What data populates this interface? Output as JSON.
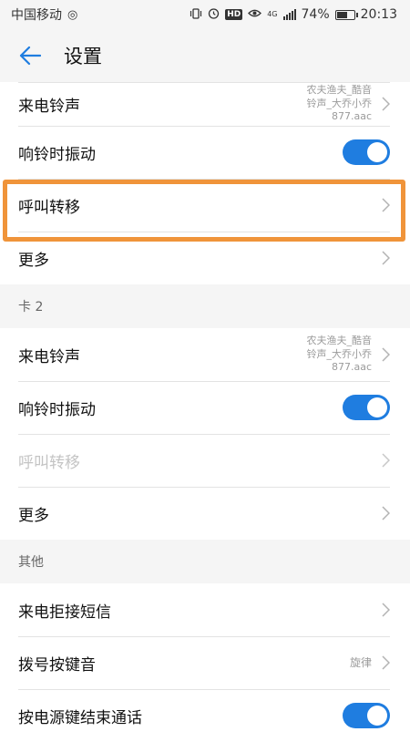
{
  "status_bar": {
    "carrier": "中国移动",
    "network_type": "4G",
    "battery": "74%",
    "battery_fraction": 0.74,
    "time": "20:13"
  },
  "header": {
    "back_icon": "arrow-left-icon",
    "title": "设置"
  },
  "sim1": {
    "ringtone_label": "来电铃声",
    "ringtone_value_line1": "农夫渔夫_酷音",
    "ringtone_value_line2": "铃声_大乔小乔",
    "ringtone_value_line3": "877.aac",
    "vibrate_label": "响铃时振动",
    "vibrate_on": true,
    "forwarding_label": "呼叫转移",
    "more_label": "更多"
  },
  "sim2": {
    "section_title": "卡 2",
    "ringtone_label": "来电铃声",
    "ringtone_value_line1": "农夫渔夫_酷音",
    "ringtone_value_line2": "铃声_大乔小乔",
    "ringtone_value_line3": "877.aac",
    "vibrate_label": "响铃时振动",
    "vibrate_on": true,
    "forwarding_label": "呼叫转移",
    "forwarding_disabled": true,
    "more_label": "更多"
  },
  "other": {
    "section_title": "其他",
    "reject_sms_label": "来电拒接短信",
    "dial_tone_label": "拨号按键音",
    "dial_tone_value": "旋律",
    "power_end_call_label": "按电源键结束通话",
    "power_end_call_on": true
  },
  "colors": {
    "accent": "#1f7de0",
    "highlight": "#f0943a"
  }
}
